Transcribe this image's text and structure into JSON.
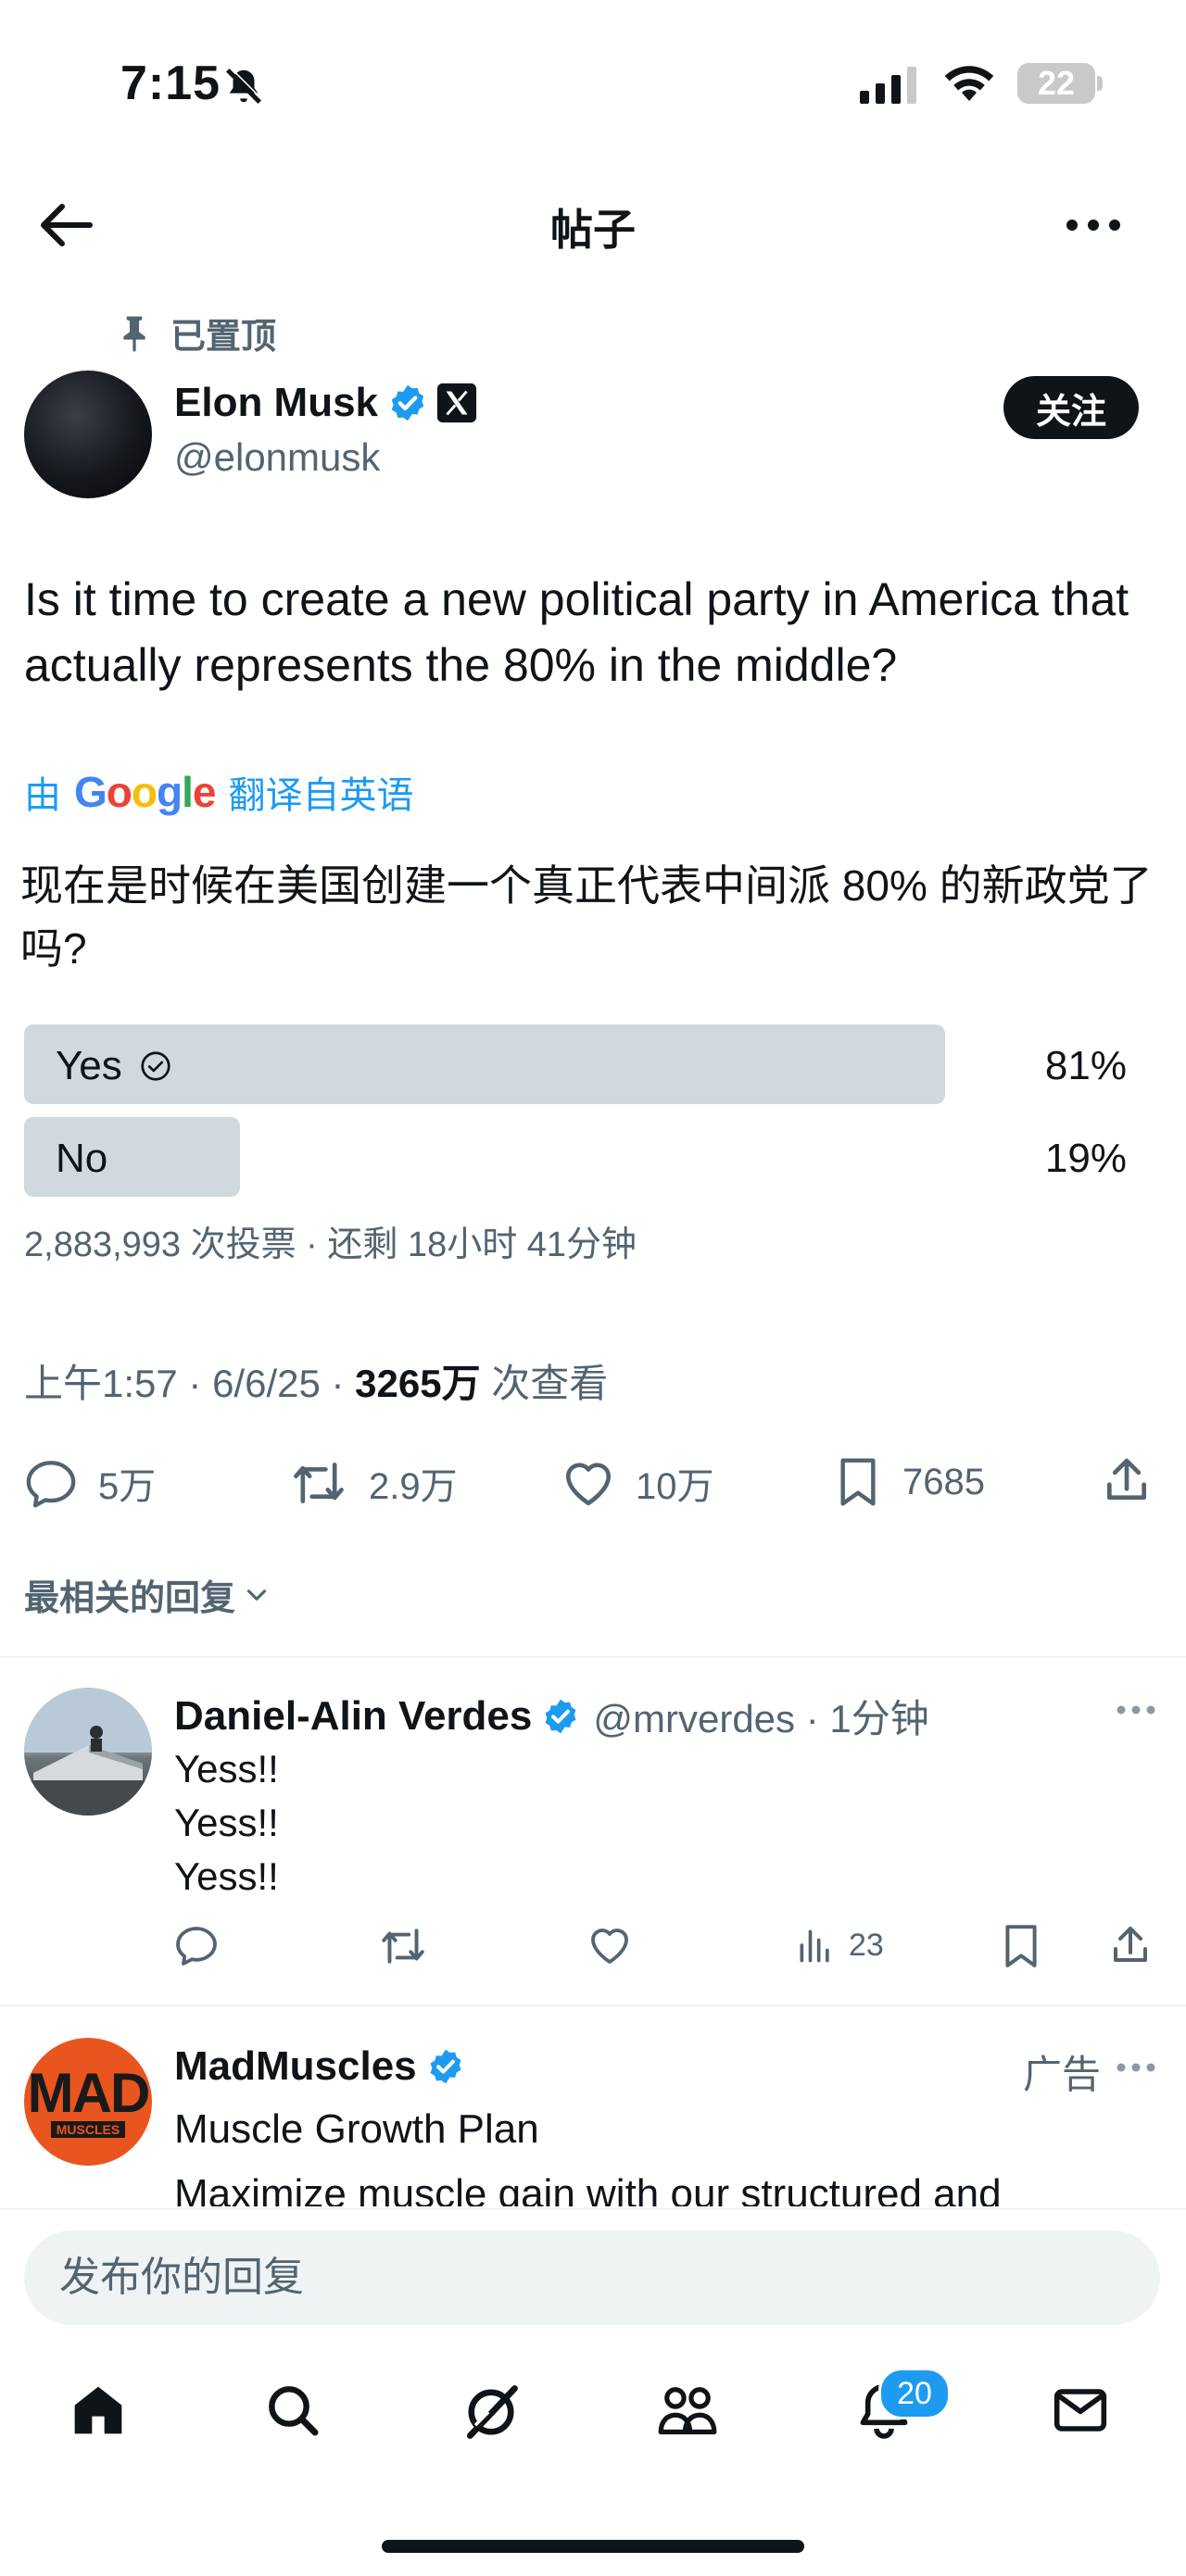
{
  "status_bar": {
    "time": "7:15",
    "battery": "22"
  },
  "header": {
    "title": "帖子"
  },
  "post": {
    "pinned_label": "已置顶",
    "author_name": "Elon Musk",
    "author_handle": "@elonmusk",
    "follow_label": "关注",
    "text": "Is it time to create a new political party in America that actually represents the 80% in the middle?",
    "translate_prefix": "由",
    "translate_brand": "Google",
    "translate_suffix": "翻译自英语",
    "translated_text": "现在是时候在美国创建一个真正代表中间派 80% 的新政党了吗?",
    "poll": {
      "options": [
        {
          "label": "Yes",
          "percent_label": "81%",
          "percent": 81,
          "selected": true
        },
        {
          "label": "No",
          "percent_label": "19%",
          "percent": 19,
          "selected": false
        }
      ],
      "meta": "2,883,993 次投票 · 还剩 18小时 41分钟"
    },
    "timestamp": "上午1:57 · 6/6/25 · ",
    "views_count": "3265万",
    "views_label": " 次查看",
    "stats": {
      "replies": "5万",
      "reposts": "2.9万",
      "likes": "10万",
      "bookmarks": "7685"
    }
  },
  "replies_sort_label": "最相关的回复",
  "reply": {
    "name": "Daniel-Alin Verdes",
    "meta": "@mrverdes · 1分钟",
    "lines": [
      "Yess!!",
      "Yess!!",
      "Yess!!"
    ],
    "views": "23"
  },
  "ad": {
    "name": "MadMuscles",
    "label": "广告",
    "logo_text": "MAD",
    "logo_sub": "MUSCLES",
    "line1": "Muscle Growth Plan",
    "line2": "Maximize muscle gain with our structured and"
  },
  "reply_box": {
    "placeholder": "发布你的回复"
  },
  "bottom_nav": {
    "notifications_badge": "20"
  },
  "colors": {
    "accent": "#1d9bf0",
    "text": "#0f1419",
    "secondary": "#536471",
    "poll_bar": "#cfd9de"
  }
}
